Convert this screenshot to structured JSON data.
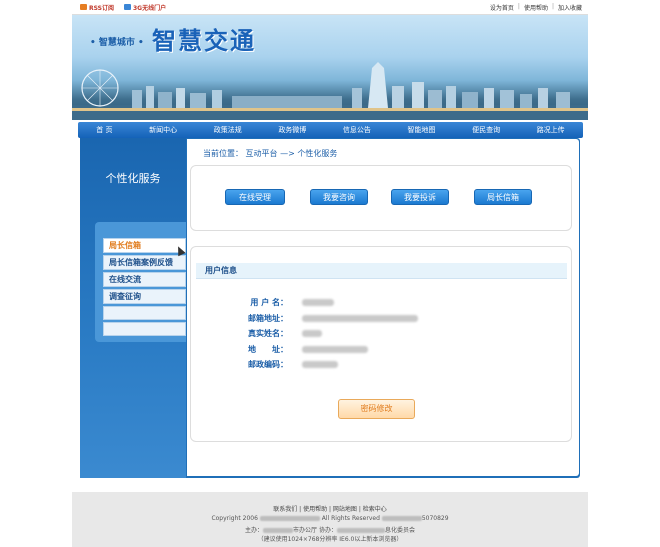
{
  "topbar": {
    "rss_label": "RSS订阅",
    "wap_label": "3G无线门户",
    "links": [
      "设为首页",
      "使用帮助",
      "加入收藏"
    ]
  },
  "banner": {
    "tag": "• 智慧城市 •",
    "title": "智慧交通"
  },
  "nav": [
    "首 页",
    "新闻中心",
    "政策法规",
    "政务微博",
    "信息公告",
    "智能地图",
    "便民查询",
    "路况上传"
  ],
  "sidebar": {
    "title": "个性化服务",
    "items": [
      "局长信箱",
      "局长信箱案例反馈",
      "在线交流",
      "调查征询",
      "",
      ""
    ],
    "active_index": 0
  },
  "breadcrumb": "当前位置： 互动平台 —> 个性化服务",
  "actions": [
    "在线受理",
    "我要咨询",
    "我要投诉",
    "局长信箱"
  ],
  "user_info": {
    "heading": "用户信息",
    "fields": [
      {
        "label": "用 户 名："
      },
      {
        "label": "邮箱地址："
      },
      {
        "label": "真实姓名："
      },
      {
        "label": "地　　址："
      },
      {
        "label": "邮政编码："
      }
    ],
    "password_button": "密码修改"
  },
  "footer": {
    "links": "联系我们 | 使用帮助 | 网站地图 | 检索中心",
    "copyright_prefix": "Copyright 2006",
    "copyright_mid": "All Rights Reserved",
    "copyright_suffix": "5070829",
    "host_prefix": "主办：",
    "host_mid": "市办公厅 协办：",
    "host_suffix": "息化委员会",
    "browser_note": "（建议使用1024×768分辨率 IE6.0以上新本浏览器）"
  },
  "colors": {
    "brand_blue": "#1f6fb8",
    "nav_blue": "#1462b8",
    "accent_orange": "#e07b1c"
  }
}
